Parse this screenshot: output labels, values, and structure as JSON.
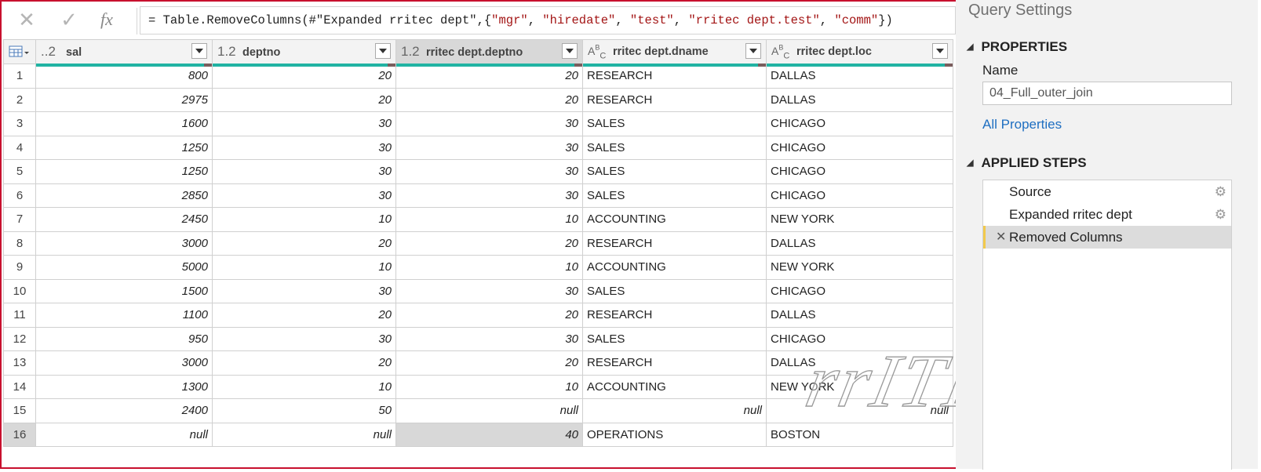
{
  "formula_bar": {
    "cancel_icon": "✕",
    "commit_icon": "✓",
    "fx_label": "fx",
    "formula_parts": [
      {
        "t": "= Table.RemoveColumns(#\"Expanded rritec dept\",{",
        "c": "plain"
      },
      {
        "t": "\"mgr\"",
        "c": "str"
      },
      {
        "t": ", ",
        "c": "plain"
      },
      {
        "t": "\"hiredate\"",
        "c": "str"
      },
      {
        "t": ", ",
        "c": "plain"
      },
      {
        "t": "\"test\"",
        "c": "str"
      },
      {
        "t": ", ",
        "c": "plain"
      },
      {
        "t": "\"rritec dept.test\"",
        "c": "str"
      },
      {
        "t": ", ",
        "c": "plain"
      },
      {
        "t": "\"comm\"",
        "c": "str"
      },
      {
        "t": "})",
        "c": "plain"
      }
    ]
  },
  "grid": {
    "columns": [
      {
        "type": "..2",
        "label": "sal",
        "align": "num"
      },
      {
        "type": "1.2",
        "label": "deptno",
        "align": "num"
      },
      {
        "type": "1.2",
        "label": "rritec dept.deptno",
        "align": "num"
      },
      {
        "type": "ABC",
        "label": "rritec dept.dname",
        "align": "txt"
      },
      {
        "type": "ABC",
        "label": "rritec dept.loc",
        "align": "txt"
      }
    ],
    "rows": [
      [
        "800",
        "20",
        "20",
        "RESEARCH",
        "DALLAS"
      ],
      [
        "2975",
        "20",
        "20",
        "RESEARCH",
        "DALLAS"
      ],
      [
        "1600",
        "30",
        "30",
        "SALES",
        "CHICAGO"
      ],
      [
        "1250",
        "30",
        "30",
        "SALES",
        "CHICAGO"
      ],
      [
        "1250",
        "30",
        "30",
        "SALES",
        "CHICAGO"
      ],
      [
        "2850",
        "30",
        "30",
        "SALES",
        "CHICAGO"
      ],
      [
        "2450",
        "10",
        "10",
        "ACCOUNTING",
        "NEW YORK"
      ],
      [
        "3000",
        "20",
        "20",
        "RESEARCH",
        "DALLAS"
      ],
      [
        "5000",
        "10",
        "10",
        "ACCOUNTING",
        "NEW YORK"
      ],
      [
        "1500",
        "30",
        "30",
        "SALES",
        "CHICAGO"
      ],
      [
        "1100",
        "20",
        "20",
        "RESEARCH",
        "DALLAS"
      ],
      [
        "950",
        "30",
        "30",
        "SALES",
        "CHICAGO"
      ],
      [
        "3000",
        "20",
        "20",
        "RESEARCH",
        "DALLAS"
      ],
      [
        "1300",
        "10",
        "10",
        "ACCOUNTING",
        "NEW YORK"
      ],
      [
        "2400",
        "50",
        "null",
        "null",
        "null"
      ],
      [
        "null",
        "null",
        "40",
        "OPERATIONS",
        "BOSTON"
      ]
    ]
  },
  "watermark": "rrITEC",
  "query_settings": {
    "title": "Query Settings",
    "properties_heading": "PROPERTIES",
    "name_label": "Name",
    "name_value": "04_Full_outer_join",
    "all_properties_link": "All Properties",
    "applied_steps_heading": "APPLIED STEPS",
    "steps": [
      {
        "label": "Source",
        "gear": true
      },
      {
        "label": "Expanded rritec dept",
        "gear": true
      },
      {
        "label": "Removed Columns",
        "gear": false,
        "active": true
      }
    ]
  },
  "colors": {
    "quality_bar": "#21b3a3",
    "frame_border": "#c8102e",
    "active_step_marker": "#f2c94c",
    "link": "#1f6fc1"
  }
}
